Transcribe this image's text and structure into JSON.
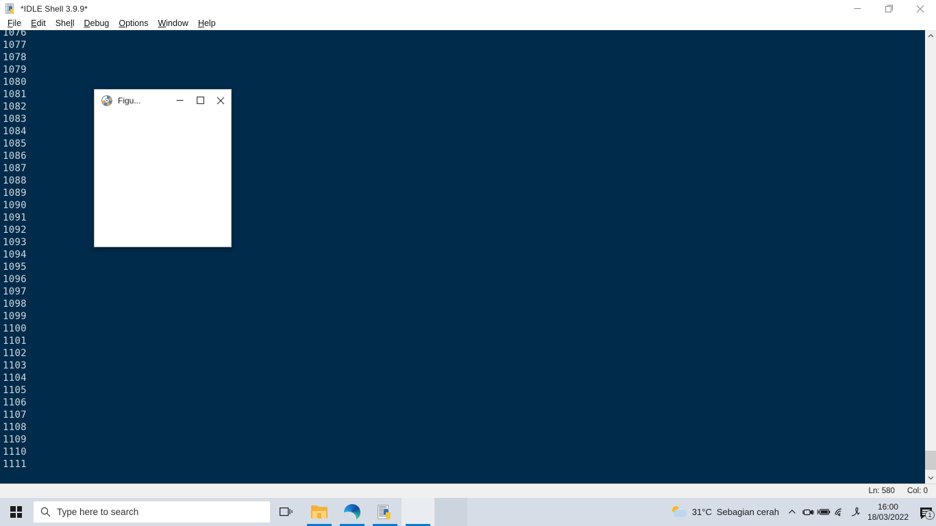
{
  "idle_window": {
    "title": "*IDLE Shell 3.9.9*",
    "icon": "python-idle-icon",
    "window_controls": {
      "minimize": "minimize-icon",
      "restore": "restore-icon",
      "close": "close-icon"
    },
    "menu": [
      {
        "label": "File",
        "mnemonic": "F"
      },
      {
        "label": "Edit",
        "mnemonic": "E"
      },
      {
        "label": "Shell",
        "mnemonic": "l"
      },
      {
        "label": "Debug",
        "mnemonic": "D"
      },
      {
        "label": "Options",
        "mnemonic": "O"
      },
      {
        "label": "Window",
        "mnemonic": "W"
      },
      {
        "label": "Help",
        "mnemonic": "H"
      }
    ],
    "shell_output": [
      "1076",
      "1077",
      "1078",
      "1079",
      "1080",
      "1081",
      "1082",
      "1083",
      "1084",
      "1085",
      "1086",
      "1087",
      "1088",
      "1089",
      "1090",
      "1091",
      "1092",
      "1093",
      "1094",
      "1095",
      "1096",
      "1097",
      "1098",
      "1099",
      "1100",
      "1101",
      "1102",
      "1103",
      "1104",
      "1105",
      "1106",
      "1107",
      "1108",
      "1109",
      "1110",
      "1111"
    ],
    "scrollbar": {
      "up_arrow": "chevron-up-icon",
      "down_arrow": "chevron-down-icon"
    },
    "status_bar": {
      "line": "Ln: 580",
      "column": "Col: 0"
    },
    "colors": {
      "shell_background": "#002B4A",
      "shell_text": "#cfd8e0",
      "status_background": "#f0f0f0"
    }
  },
  "figure_window": {
    "title": "Figu...",
    "icon": "matplotlib-icon",
    "window_controls": {
      "minimize": "minimize-icon",
      "maximize": "maximize-icon",
      "close": "close-icon"
    },
    "canvas": {
      "content": "",
      "background": "#ffffff"
    }
  },
  "taskbar": {
    "start_button": "windows-logo-icon",
    "search": {
      "icon": "search-icon",
      "placeholder": "Type here to search",
      "value": ""
    },
    "task_view": "task-view-icon",
    "pinned_apps": [
      {
        "name": "file-explorer",
        "icon": "file-explorer-icon",
        "running": true
      },
      {
        "name": "microsoft-edge",
        "icon": "edge-icon",
        "running": true
      },
      {
        "name": "python-idle",
        "icon": "python-idle-icon",
        "running": true
      },
      {
        "name": "matplotlib-figure",
        "icon": "figure-window-icon",
        "running": true
      }
    ],
    "weather": {
      "icon": "partly-cloudy-icon",
      "temperature": "31°C",
      "description": "Sebagian cerah"
    },
    "tray_icons": [
      {
        "name": "show-hidden-icons",
        "icon": "chevron-up-icon"
      },
      {
        "name": "camera",
        "icon": "camera-icon"
      },
      {
        "name": "battery",
        "icon": "battery-charging-icon"
      },
      {
        "name": "network",
        "icon": "wifi-icon"
      },
      {
        "name": "pen-workspace",
        "icon": "pen-icon"
      }
    ],
    "clock": {
      "time": "16:00",
      "date": "18/03/2022"
    },
    "notifications": {
      "icon": "notification-icon",
      "count": "1"
    }
  }
}
